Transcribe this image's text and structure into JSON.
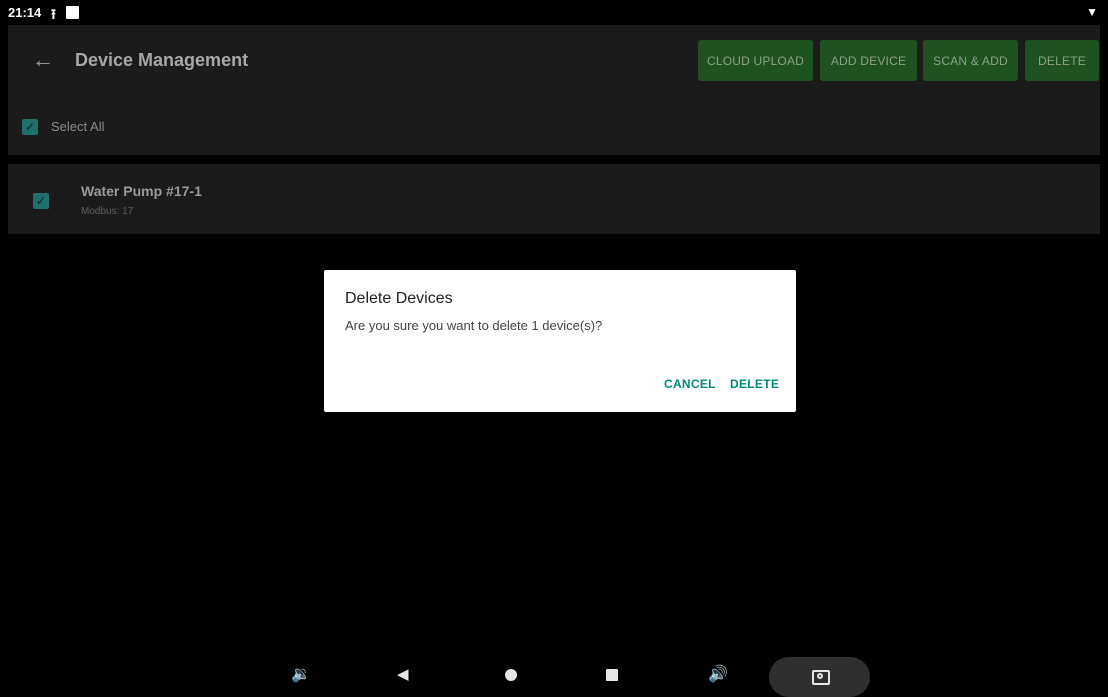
{
  "status_bar": {
    "time": "21:14",
    "upload_icon": "upload-icon",
    "notification_icon": "notification-square-icon",
    "wifi_icon": "wifi-icon"
  },
  "app_bar": {
    "back_icon": "arrow-back-icon",
    "title": "Device Management",
    "buttons": {
      "cloud_upload": "CLOUD UPLOAD",
      "add_device": "ADD DEVICE",
      "scan_add": "SCAN & ADD",
      "delete": "DELETE"
    },
    "button_color": "#1f5221"
  },
  "select_all": {
    "label": "Select All",
    "checked": true
  },
  "devices": [
    {
      "name": "Water Pump #17-1",
      "subtitle": "Modbus: 17",
      "checked": true
    }
  ],
  "dialog": {
    "title": "Delete Devices",
    "message": "Are you sure you want to delete 1 device(s)?",
    "cancel": "CANCEL",
    "confirm": "DELETE",
    "accent": "#00897b"
  },
  "nav_bar": {
    "icons": [
      "volume-down-icon",
      "back-triangle-icon",
      "home-dot-icon",
      "recents-square-icon",
      "volume-up-icon",
      "camera-icon"
    ]
  }
}
